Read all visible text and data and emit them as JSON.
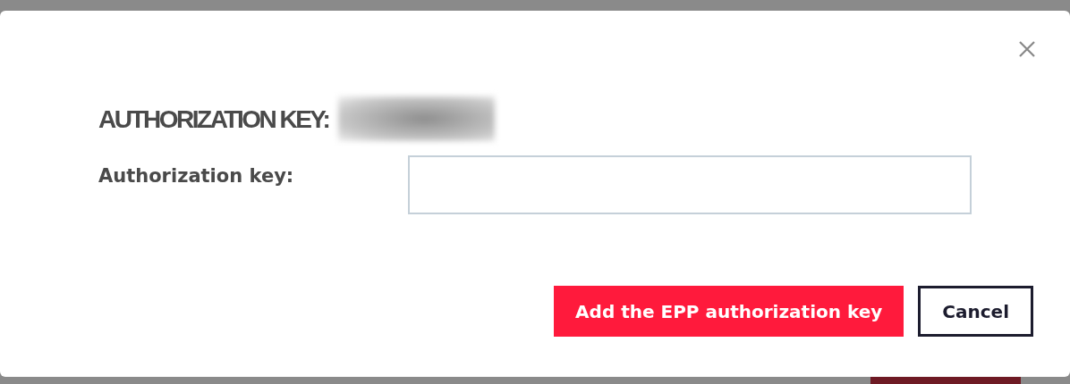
{
  "dialog": {
    "title": "AUTHORIZATION KEY:",
    "title_value_redacted": true,
    "fields": [
      {
        "label": "Authorization key:"
      }
    ],
    "buttons": [
      {
        "label": "Add the EPP authorization key",
        "kind": "primary"
      },
      {
        "label": "Cancel",
        "kind": "secondary"
      }
    ]
  }
}
